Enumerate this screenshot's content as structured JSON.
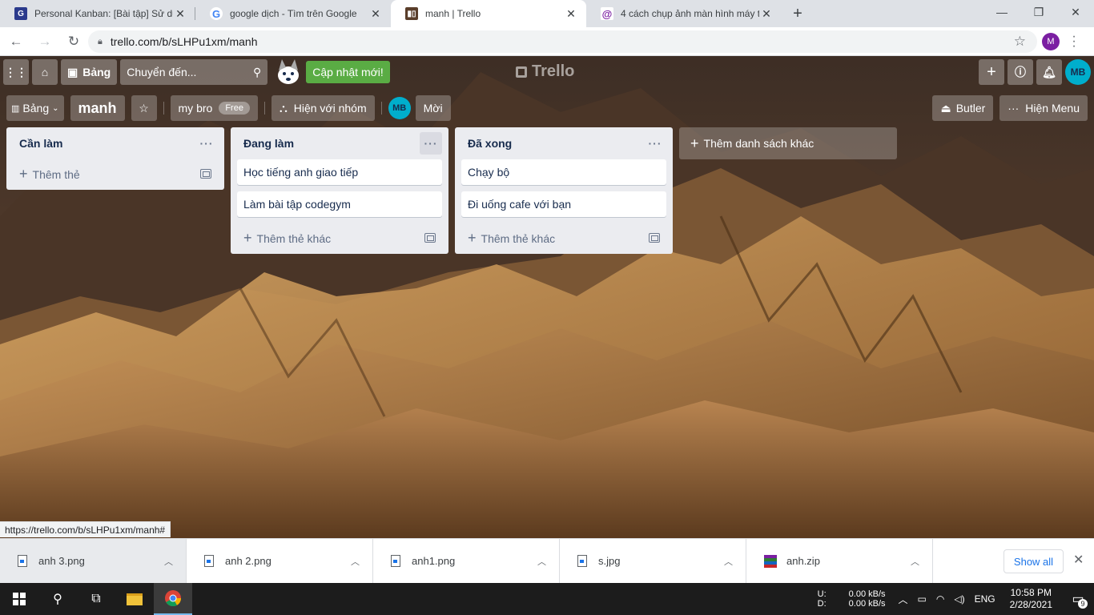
{
  "browser": {
    "tabs": [
      {
        "title": "Personal Kanban: [Bài tập] Sử dụ",
        "icon": "codegym-icon",
        "active": false
      },
      {
        "title": "google dịch - Tìm trên Google",
        "icon": "google-icon",
        "active": false
      },
      {
        "title": "manh | Trello",
        "icon": "trello-icon",
        "active": true
      },
      {
        "title": "4 cách chụp ảnh màn hình máy tí",
        "icon": "site-icon",
        "active": false
      }
    ],
    "url": "trello.com/b/sLHPu1xm/manh",
    "profile_initial": "M",
    "status_url": "https://trello.com/b/sLHPu1xm/manh#"
  },
  "trello_header": {
    "boards_label": "Bảng",
    "search_placeholder": "Chuyển đến...",
    "update_label": "Cập nhật mới!",
    "logo": "Trello",
    "avatar": "MB"
  },
  "board_header": {
    "view_label": "Bảng",
    "board_name": "manh",
    "team_name": "my bro",
    "team_badge": "Free",
    "visibility_label": "Hiện với nhóm",
    "member_avatar": "MB",
    "invite_label": "Mời",
    "butler_label": "Butler",
    "menu_label": "Hiện Menu"
  },
  "lists": [
    {
      "title": "Cần làm",
      "cards": [],
      "add_label": "Thêm thẻ"
    },
    {
      "title": "Đang làm",
      "cards": [
        "Học tiếng anh giao tiếp",
        "Làm bài tập codegym"
      ],
      "add_label": "Thêm thẻ khác"
    },
    {
      "title": "Đã xong",
      "cards": [
        "Chạy bộ",
        "Đi uống cafe với bạn"
      ],
      "add_label": "Thêm thẻ khác"
    }
  ],
  "add_list_label": "Thêm danh sách khác",
  "downloads": {
    "items": [
      "anh 3.png",
      "anh 2.png",
      "anh1.png",
      "s.jpg",
      "anh.zip"
    ],
    "show_all": "Show all"
  },
  "taskbar": {
    "net_up_label": "U:",
    "net_down_label": "D:",
    "net_up": "0.00 kB/s",
    "net_down": "0.00 kB/s",
    "lang": "ENG",
    "time": "10:58 PM",
    "date": "2/28/2021",
    "notif_count": "9"
  }
}
